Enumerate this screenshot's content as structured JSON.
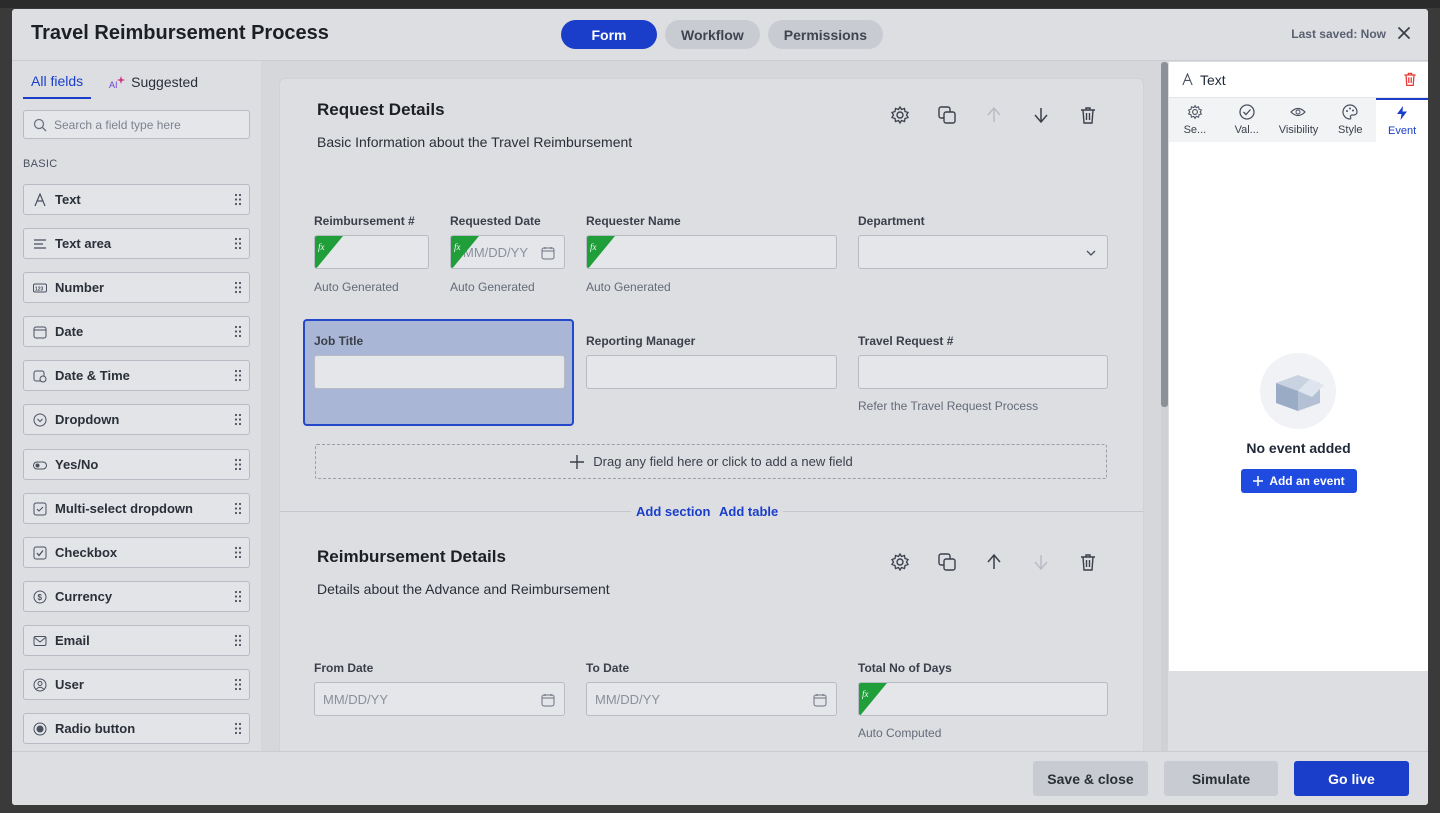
{
  "header": {
    "title": "Travel Reimbursement Process",
    "tabs": [
      {
        "label": "Form",
        "active": true
      },
      {
        "label": "Workflow",
        "active": false
      },
      {
        "label": "Permissions",
        "active": false
      }
    ],
    "last_saved": "Last saved: Now",
    "close_icon": "close-icon"
  },
  "left_panel": {
    "tabs": [
      {
        "label": "All fields",
        "active": true
      },
      {
        "label": "Suggested",
        "active": false,
        "icon": "ai-sparkle-icon"
      }
    ],
    "search_placeholder": "Search a field type here",
    "group_label": "BASIC",
    "fields": [
      {
        "label": "Text",
        "icon": "text-icon"
      },
      {
        "label": "Text area",
        "icon": "text-area-icon"
      },
      {
        "label": "Number",
        "icon": "number-icon"
      },
      {
        "label": "Date",
        "icon": "date-icon"
      },
      {
        "label": "Date & Time",
        "icon": "date-time-icon"
      },
      {
        "label": "Dropdown",
        "icon": "dropdown-icon"
      },
      {
        "label": "Yes/No",
        "icon": "toggle-icon"
      },
      {
        "label": "Multi-select dropdown",
        "icon": "multi-select-icon"
      },
      {
        "label": "Checkbox",
        "icon": "checkbox-icon"
      },
      {
        "label": "Currency",
        "icon": "currency-icon"
      },
      {
        "label": "Email",
        "icon": "email-icon"
      },
      {
        "label": "User",
        "icon": "user-icon"
      },
      {
        "label": "Radio button",
        "icon": "radio-icon"
      }
    ]
  },
  "form": {
    "sections": [
      {
        "title": "Request Details",
        "subtitle": "Basic Information about the Travel Reimbursement",
        "fields": [
          {
            "label": "Reimbursement #",
            "placeholder": "",
            "hint": "Auto Generated"
          },
          {
            "label": "Requested Date",
            "placeholder": "MM/DD/YY",
            "hint": "Auto Generated"
          },
          {
            "label": "Requester Name",
            "placeholder": "",
            "hint": "Auto Generated"
          },
          {
            "label": "Department",
            "placeholder": "",
            "hint": ""
          },
          {
            "label": "Job Title",
            "placeholder": "",
            "hint": ""
          },
          {
            "label": "Reporting Manager",
            "placeholder": "",
            "hint": ""
          },
          {
            "label": "Travel Request #",
            "placeholder": "",
            "hint": "Refer the Travel Request Process"
          }
        ],
        "dropzone": "Drag any field here or click to add a new field"
      },
      {
        "title": "Reimbursement Details",
        "subtitle": "Details about the Advance and Reimbursement",
        "fields": [
          {
            "label": "From Date",
            "placeholder": "MM/DD/YY",
            "hint": ""
          },
          {
            "label": "To Date",
            "placeholder": "MM/DD/YY",
            "hint": ""
          },
          {
            "label": "Total No of Days",
            "placeholder": "",
            "hint": "Auto Computed"
          }
        ]
      }
    ],
    "add_section": "Add section",
    "add_table": "Add table",
    "fx_badge": "fx"
  },
  "right_panel": {
    "title": "Text",
    "tabs": [
      {
        "label": "Se...",
        "icon": "gear-icon"
      },
      {
        "label": "Val...",
        "icon": "check-circle-icon"
      },
      {
        "label": "Visibility",
        "icon": "eye-icon"
      },
      {
        "label": "Style",
        "icon": "palette-icon"
      },
      {
        "label": "Event",
        "icon": "lightning-icon",
        "active": true
      }
    ],
    "empty_title": "No event added",
    "add_event": "Add an event"
  },
  "footer": {
    "save_close": "Save & close",
    "simulate": "Simulate",
    "go_live": "Go live"
  },
  "colors": {
    "primary": "#1a3ec9",
    "fx_green": "#1f9e3a",
    "danger": "#e53935"
  }
}
